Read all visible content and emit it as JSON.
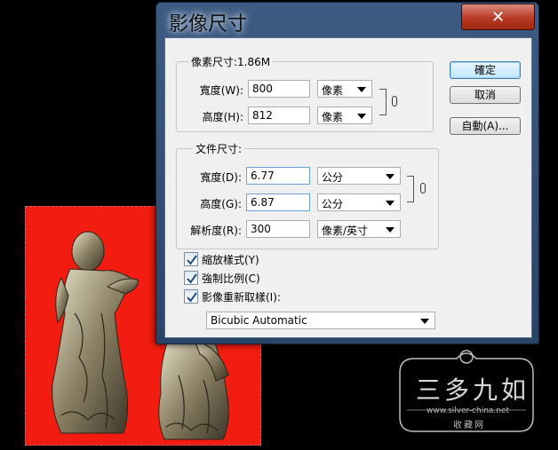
{
  "dialog": {
    "title": "影像尺寸",
    "close_label": "✕"
  },
  "pixel_dimensions": {
    "legend": "像素尺寸:1.86M",
    "width_label": "寬度(W):",
    "width_value": "800",
    "width_unit": "像素",
    "height_label": "高度(H):",
    "height_value": "812",
    "height_unit": "像素"
  },
  "document_size": {
    "legend": "文件尺寸:",
    "width_label": "寬度(D):",
    "width_value": "6.77",
    "width_unit": "公分",
    "height_label": "高度(G):",
    "height_value": "6.87",
    "height_unit": "公分",
    "resolution_label": "解析度(R):",
    "resolution_value": "300",
    "resolution_unit": "像素/英寸"
  },
  "options": {
    "scale_styles": {
      "label": "縮放樣式(Y)",
      "checked": true
    },
    "constrain_proportions": {
      "label": "強制比例(C)",
      "checked": true
    },
    "resample_image": {
      "label": "影像重新取樣(I):",
      "checked": true
    },
    "resample_method": "Bicubic Automatic"
  },
  "buttons": {
    "ok": "確定",
    "cancel": "取消",
    "auto": "自動(A)..."
  },
  "watermark": {
    "name": "三多九如",
    "url": "www.silver-china.net",
    "sub": "收藏网"
  },
  "colors": {
    "photo_background": "#f21d10",
    "titlebar": "#3d5b82",
    "close_button": "#b93a25"
  }
}
